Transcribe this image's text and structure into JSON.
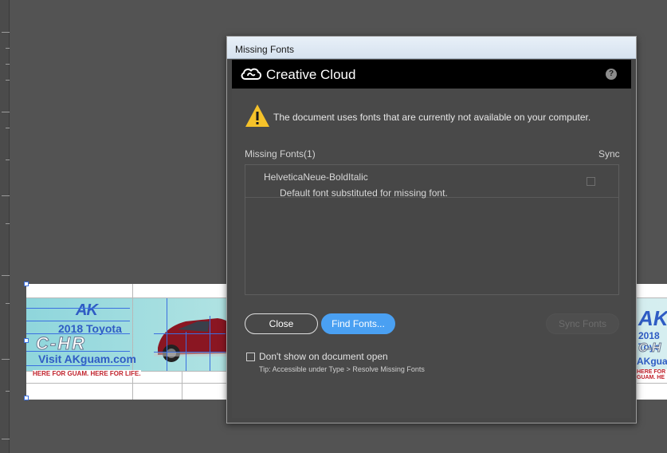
{
  "dialog": {
    "window_title": "Missing Fonts",
    "brand": "Creative Cloud",
    "help_glyph": "?",
    "warning": "The document uses fonts that are currently not available on your computer.",
    "list_header": "Missing Fonts(1)",
    "sync_header": "Sync",
    "fonts": [
      {
        "name": "HelveticaNeue-BoldItalic",
        "detail": "Default font substituted for missing font.",
        "sync_checked": false
      }
    ],
    "buttons": {
      "close": "Close",
      "find": "Find Fonts...",
      "sync": "Sync Fonts"
    },
    "dont_show_label": "Don't show on document open",
    "dont_show_checked": false,
    "tip": "Tip: Accessible under Type > Resolve Missing Fonts"
  },
  "artboard": {
    "logo": "AK",
    "line1": "2018 Toyota",
    "line2": "C-HR",
    "line3": "Visit AKguam.com",
    "tagline": "HERE FOR GUAM. HERE FOR LIFE.",
    "right_logo": "AK",
    "right_line1": "2018 Toyo",
    "right_line2": "C-H",
    "right_line3": "AKguam.c",
    "right_tagline": "HERE FOR GUAM. HE"
  },
  "colors": {
    "accent": "#4aa0f2",
    "warning": "#f5c22a",
    "guide": "#3b6fe0"
  },
  "icons": [
    "creative-cloud-logo-icon",
    "help-icon",
    "warning-icon",
    "checkbox-icon"
  ]
}
